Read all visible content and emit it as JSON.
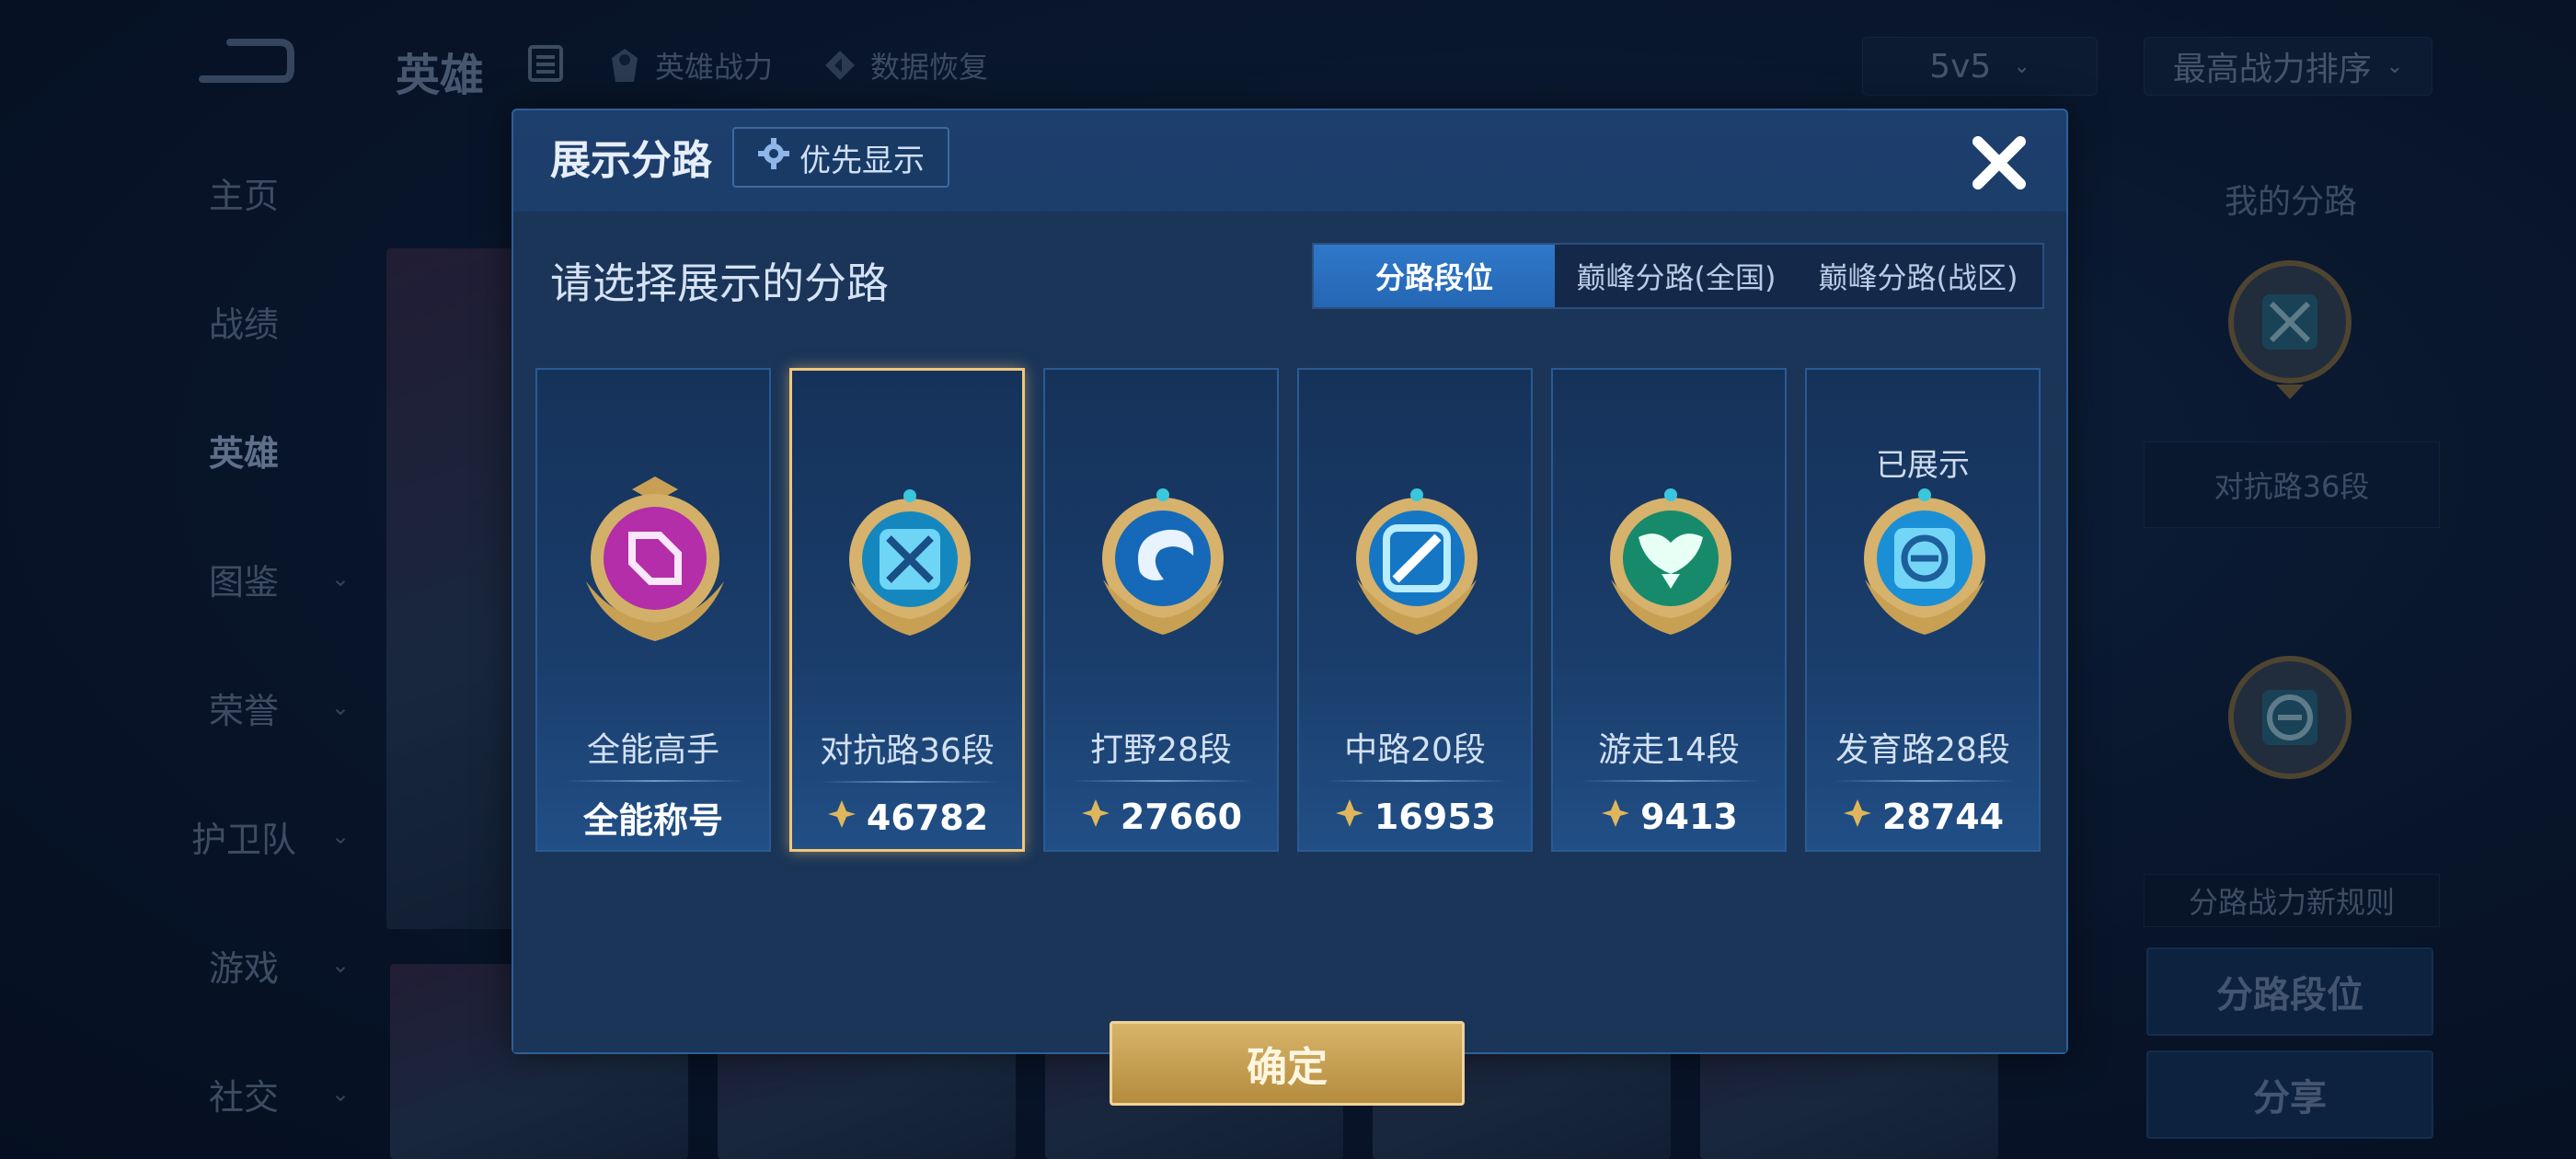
{
  "topbar": {
    "title": "英雄",
    "links": [
      "英雄战力",
      "数据恢复"
    ],
    "mode_select": "5v5",
    "sort_select": "最高战力排序"
  },
  "sidebar": {
    "items": [
      {
        "label": "主页",
        "chevron": false
      },
      {
        "label": "战绩",
        "chevron": false
      },
      {
        "label": "英雄",
        "chevron": false,
        "active": true
      },
      {
        "label": "图鉴",
        "chevron": true
      },
      {
        "label": "荣誉",
        "chevron": true
      },
      {
        "label": "护卫队",
        "chevron": true
      },
      {
        "label": "游戏",
        "chevron": true
      },
      {
        "label": "社交",
        "chevron": true
      }
    ]
  },
  "right_panel": {
    "title": "我的分路",
    "lane_label": "对抗路36段",
    "rule_label": "分路战力新规则",
    "lane_rank_button": "分路段位",
    "share_button": "分享"
  },
  "modal": {
    "title": "展示分路",
    "priority_button": "优先显示",
    "subtitle": "请选择展示的分路",
    "tabs": [
      {
        "label": "分路段位",
        "active": true
      },
      {
        "label": "巅峰分路(全国)",
        "active": false
      },
      {
        "label": "巅峰分路(战区)",
        "active": false
      }
    ],
    "cards": [
      {
        "name": "全能高手",
        "value": "全能称号",
        "icon": "all-round-emblem",
        "color": "#c83fc0",
        "selected": false,
        "shown": ""
      },
      {
        "name": "对抗路36段",
        "value": "46782",
        "icon": "clash-lane-emblem",
        "color": "#2aa6d8",
        "selected": true,
        "shown": ""
      },
      {
        "name": "打野28段",
        "value": "27660",
        "icon": "jungle-emblem",
        "color": "#2a88d0",
        "selected": false,
        "shown": ""
      },
      {
        "name": "中路20段",
        "value": "16953",
        "icon": "mid-lane-emblem",
        "color": "#2a94d8",
        "selected": false,
        "shown": ""
      },
      {
        "name": "游走14段",
        "value": "9413",
        "icon": "roam-emblem",
        "color": "#1f9a7a",
        "selected": false,
        "shown": ""
      },
      {
        "name": "发育路28段",
        "value": "28744",
        "icon": "farm-lane-emblem",
        "color": "#2a9ad8",
        "selected": false,
        "shown": "已展示"
      }
    ],
    "confirm_button": "确定"
  },
  "colors": {
    "accent_gold": "#f0c77a",
    "tab_active": "#2f78c9",
    "modal_bg": "#1a3558"
  }
}
